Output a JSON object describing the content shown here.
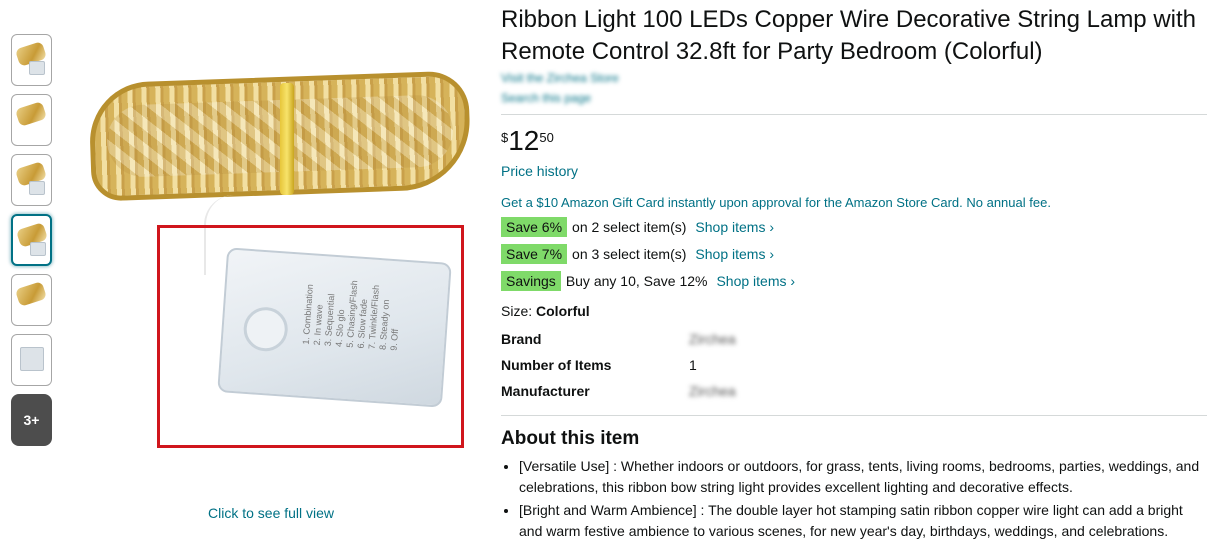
{
  "thumbnails": {
    "more_label": "3+"
  },
  "main_image": {
    "battery_label": "1. Combination\n2. In wave\n3. Sequential\n4. Slo glo\n5. Chasing/Flash\n6. Slow fade\n7. Twinkle/Flash\n8. Steady on\n9. Off",
    "full_view_link": "Click to see full view"
  },
  "product": {
    "title": "Ribbon Light 100 LEDs Copper Wire Decorative String Lamp with Remote Control 32.8ft for Party Bedroom (Colorful)",
    "store_link": "Visit the Zirchea Store",
    "search_link": "Search this page",
    "price_symbol": "$",
    "price_whole": "12",
    "price_fraction": "50",
    "price_history": "Price history",
    "promo": "Get a $10 Amazon Gift Card instantly upon approval for the Amazon Store Card. No annual fee.",
    "savings": [
      {
        "badge": "Save 6%",
        "text": "on 2 select item(s)",
        "link": "Shop items ›"
      },
      {
        "badge": "Save 7%",
        "text": "on 3 select item(s)",
        "link": "Shop items ›"
      },
      {
        "badge": "Savings",
        "text": "Buy any 10, Save 12%",
        "link": "Shop items ›"
      }
    ],
    "size_label": "Size:",
    "size_value": "Colorful",
    "specs": [
      {
        "key": "Brand",
        "value": "Zirchea"
      },
      {
        "key": "Number of Items",
        "value": "1"
      },
      {
        "key": "Manufacturer",
        "value": "Zirchea"
      }
    ],
    "about_heading": "About this item",
    "bullets": [
      "[Versatile Use] : Whether indoors or outdoors, for grass, tents, living rooms, bedrooms, parties, weddings, and celebrations, this ribbon bow string light provides excellent lighting and decorative effects.",
      "[Bright and Warm Ambience] : The double layer hot stamping satin ribbon copper wire light can add a bright and warm festive ambience to various scenes, for new year's day, birthdays, weddings, and celebrations."
    ]
  }
}
